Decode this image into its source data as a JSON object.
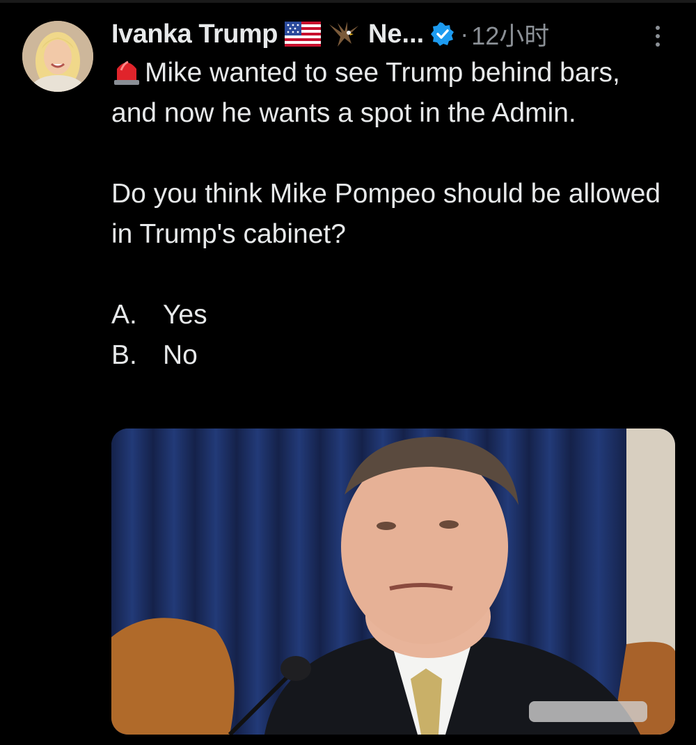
{
  "post": {
    "author_name": "Ivanka Trump",
    "handle_truncated": "Ne...",
    "separator": "·",
    "time": "12小时",
    "flag_icon": "us-flag-icon",
    "eagle_icon": "eagle-icon",
    "verified_icon": "verified-badge-icon",
    "more_icon": "more-vertical-icon",
    "text": {
      "line_intro": "Mike wanted to see Trump behind bars, and now he wants a spot in the Admin.",
      "question": "Do you think Mike Pompeo should be allowed in Trump's cabinet?",
      "options": [
        {
          "letter": "A.",
          "label": "Yes"
        },
        {
          "letter": "B.",
          "label": "No"
        }
      ],
      "lead_icon": "siren-icon"
    },
    "media": {
      "description_icon": "photo"
    }
  },
  "colors": {
    "background": "#000000",
    "text_primary": "#e7e9ea",
    "text_secondary": "#8b9096",
    "verified_blue": "#1d9bf0"
  }
}
